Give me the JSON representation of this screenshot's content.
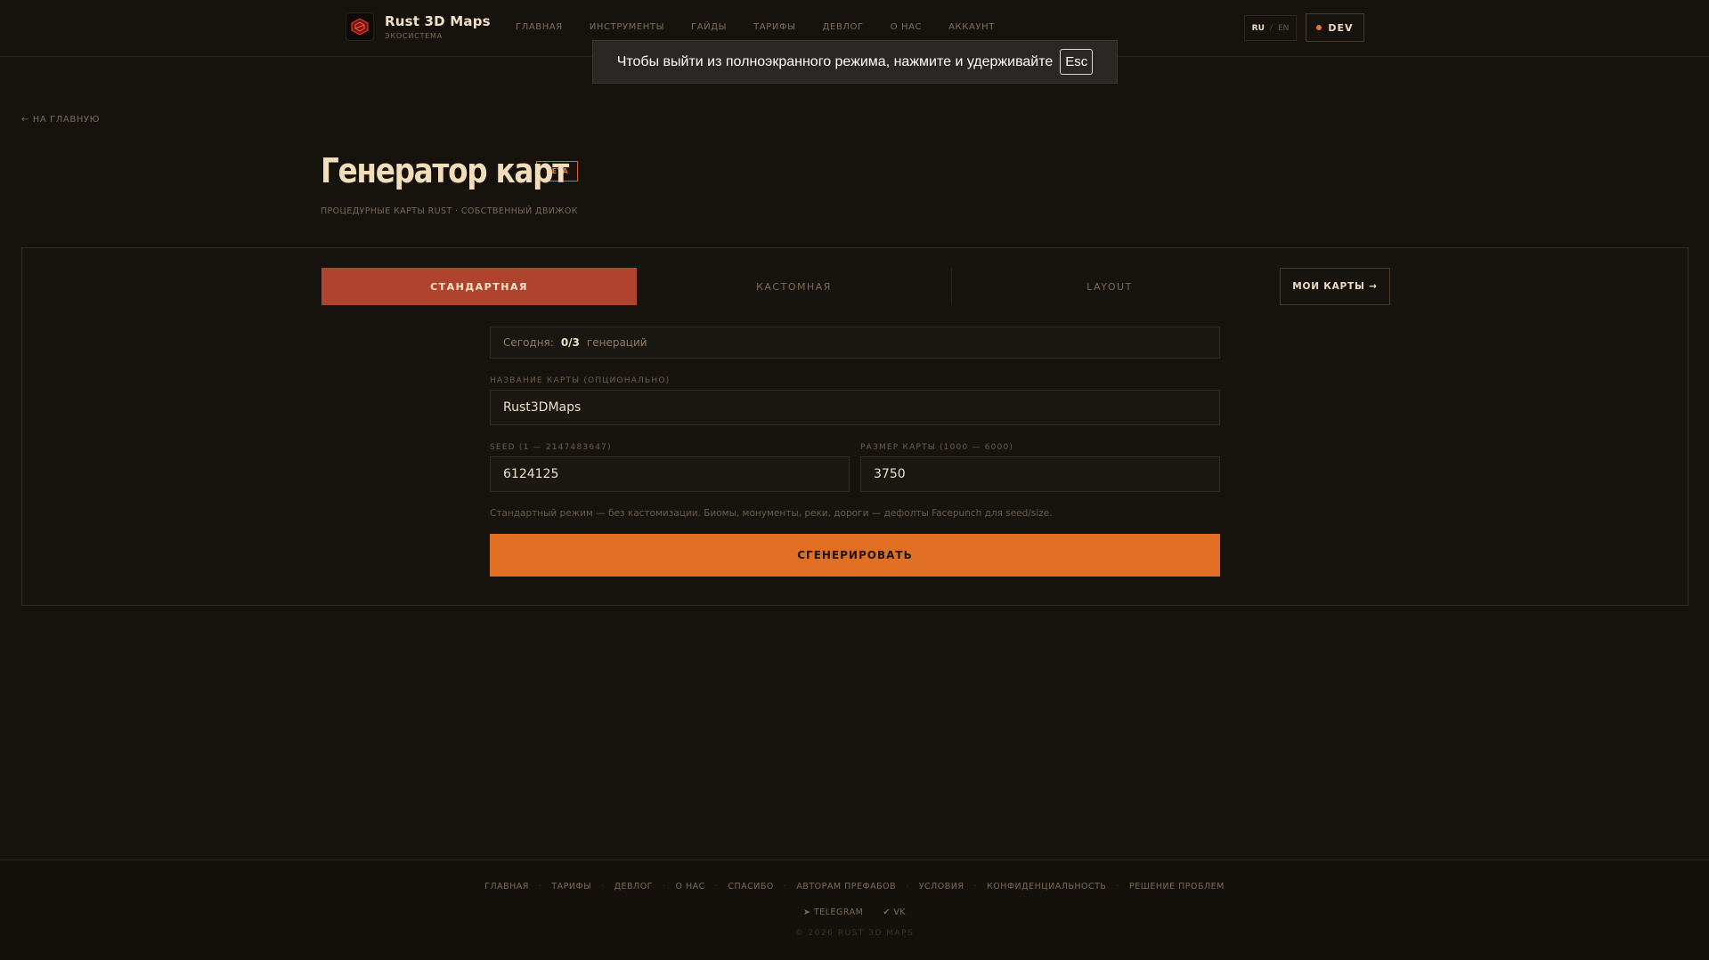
{
  "header": {
    "logo_title": "Rust 3D Maps",
    "logo_subtitle": "ЭКОСИСТЕМА",
    "nav": [
      "ГЛАВНАЯ",
      "ИНСТРУМЕНТЫ",
      "ГАЙДЫ",
      "ТАРИФЫ",
      "ДЕВЛОГ",
      "О НАС",
      "АККАУНТ"
    ],
    "lang_active": "RU",
    "lang_sep": "/",
    "lang_other": "EN",
    "dev_label": "DEV"
  },
  "toast": {
    "text": "Чтобы выйти из полноэкранного режима, нажмите и удерживайте",
    "key": "Esc"
  },
  "back_link": "← НА ГЛАВНУЮ",
  "page": {
    "title": "Генератор карт",
    "badge": "БЕТА",
    "subtitle": "ПРОЦЕДУРНЫЕ КАРТЫ RUST · СОБСТВЕННЫЙ ДВИЖОК"
  },
  "tabs": [
    "СТАНДАРТНАЯ",
    "КАСТОМНАЯ",
    "LAYOUT"
  ],
  "my_maps": "МОИ КАРТЫ →",
  "form": {
    "today_label": "Сегодня:",
    "today_value": "0/3",
    "today_suffix": "генераций",
    "name_label": "НАЗВАНИЕ КАРТЫ (ОПЦИОНАЛЬНО)",
    "name_value": "Rust3DMaps",
    "seed_label": "SEED (1 — 2147483647)",
    "seed_value": "6124125",
    "size_label": "РАЗМЕР КАРТЫ (1000 — 6000)",
    "size_value": "3750",
    "hint": "Стандартный режим — без кастомизации. Биомы, монументы, реки, дороги — дефолты Facepunch для seed/size.",
    "generate": "СГЕНЕРИРОВАТЬ"
  },
  "footer": {
    "links": [
      "ГЛАВНАЯ",
      "ТАРИФЫ",
      "ДЕВЛОГ",
      "О НАС",
      "СПАСИБО",
      "АВТОРАМ ПРЕФАБОВ",
      "УСЛОВИЯ",
      "КОНФИДЕНЦИАЛЬНОСТЬ",
      "РЕШЕНИЕ ПРОБЛЕМ"
    ],
    "telegram": "TELEGRAM",
    "vk": "VK",
    "copyright": "© 2026 RUST 3D MAPS"
  },
  "colors": {
    "accent": "#e06e23",
    "tab_active": "#b0432d",
    "background": "#16120e"
  }
}
